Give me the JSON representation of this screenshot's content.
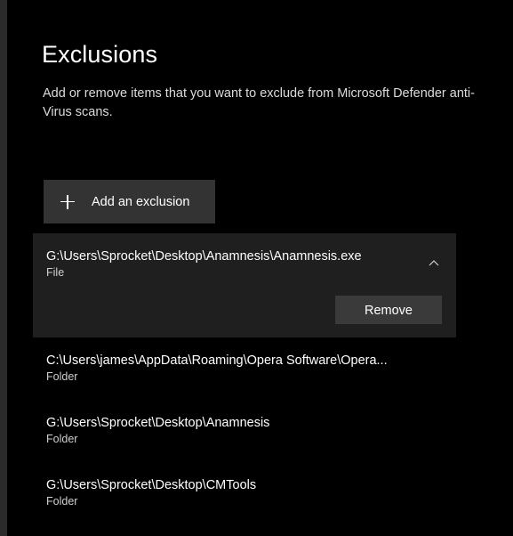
{
  "page": {
    "title": "Exclusions",
    "description": "Add or remove items that you want to exclude from Microsoft Defender anti-Virus scans."
  },
  "actions": {
    "add_label": "Add an exclusion",
    "add_icon": "plus-icon"
  },
  "exclusions": [
    {
      "path": "G:\\Users\\Sprocket\\Desktop\\Anamnesis\\Anamnesis.exe",
      "type": "File",
      "expanded": true,
      "remove_label": "Remove"
    },
    {
      "path": "C:\\Users\\james\\AppData\\Roaming\\Opera Software\\Opera...",
      "type": "Folder"
    },
    {
      "path": "G:\\Users\\Sprocket\\Desktop\\Anamnesis",
      "type": "Folder"
    },
    {
      "path": "G:\\Users\\Sprocket\\Desktop\\CMTools",
      "type": "Folder"
    }
  ],
  "colors": {
    "background": "#000000",
    "button": "#333333",
    "expanded_item": "#1f1f1f",
    "remove_button": "#3a3a3a"
  }
}
